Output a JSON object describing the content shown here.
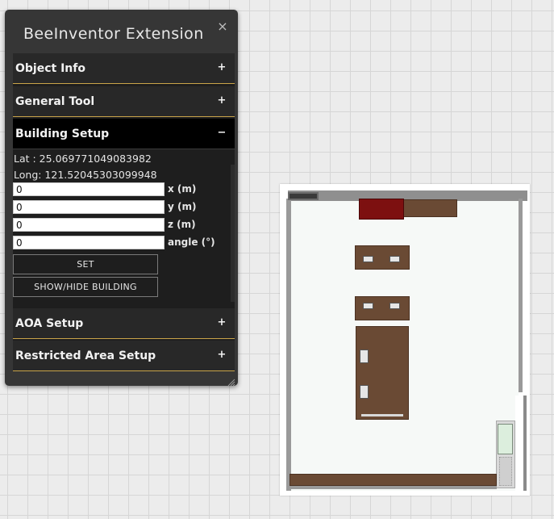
{
  "panel": {
    "title": "BeeInventor Extension",
    "close_glyph": "×",
    "sections": [
      {
        "label": "Object Info",
        "state": "collapsed",
        "icon": "+"
      },
      {
        "label": "General Tool",
        "state": "collapsed",
        "icon": "+"
      },
      {
        "label": "Building Setup",
        "state": "expanded",
        "icon": "−"
      },
      {
        "label": "AOA Setup",
        "state": "collapsed",
        "icon": "+"
      },
      {
        "label": "Restricted Area Setup",
        "state": "collapsed",
        "icon": "+"
      }
    ],
    "building_setup": {
      "lat_text": "Lat : 25.069771049083982",
      "long_text": "Long: 121.52045303099948",
      "fields": [
        {
          "label": "x (m)",
          "value": "0"
        },
        {
          "label": "y (m)",
          "value": "0"
        },
        {
          "label": "z (m)",
          "value": "0"
        },
        {
          "label": "angle (°)",
          "value": "0"
        }
      ],
      "set_button": "SET",
      "toggle_button": "SHOW/HIDE BUILDING"
    }
  },
  "icons": {
    "close": "close-icon",
    "expand": "plus-icon",
    "collapse": "minus-icon",
    "resize": "resize-grip-icon"
  },
  "colors": {
    "panel_bg": "#363636",
    "body_bg": "#1e1e1e",
    "header_bg": "#282828",
    "active_header_bg": "#000000",
    "accent_rule": "#c9a449",
    "canvas_bg": "#ececec"
  }
}
